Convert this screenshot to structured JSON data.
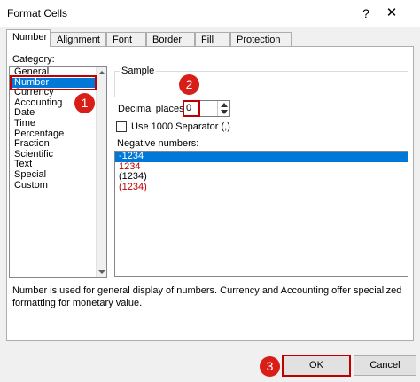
{
  "window": {
    "title": "Format Cells",
    "help_glyph": "?",
    "close_glyph": "✕"
  },
  "tabs": [
    {
      "label": "Number",
      "active": true
    },
    {
      "label": "Alignment"
    },
    {
      "label": "Font"
    },
    {
      "label": "Border"
    },
    {
      "label": "Fill"
    },
    {
      "label": "Protection"
    }
  ],
  "category": {
    "label": "Category:",
    "items": [
      "General",
      "Number",
      "Currency",
      "Accounting",
      "Date",
      "Time",
      "Percentage",
      "Fraction",
      "Scientific",
      "Text",
      "Special",
      "Custom"
    ],
    "selected": "Number"
  },
  "sample": {
    "label": "Sample",
    "value": ""
  },
  "decimal_places": {
    "label": "Decimal places:",
    "value": "0"
  },
  "thousand_separator": {
    "label": "Use 1000 Separator (,)",
    "checked": false
  },
  "negative_numbers": {
    "label": "Negative numbers:",
    "items": [
      {
        "text": "-1234",
        "color": "#000000",
        "selected": true
      },
      {
        "text": "1234",
        "color": "#c00000"
      },
      {
        "text": "(1234)",
        "color": "#000000"
      },
      {
        "text": "(1234)",
        "color": "#c00000"
      }
    ]
  },
  "description": "Number is used for general display of numbers.  Currency and Accounting offer specialized formatting for monetary value.",
  "buttons": {
    "ok": "OK",
    "cancel": "Cancel"
  },
  "callouts": [
    "1",
    "2",
    "3"
  ],
  "colors": {
    "accent": "#0078d7",
    "highlight_box": "#c00000",
    "callout": "#d91e18",
    "negative_red": "#c00000"
  }
}
